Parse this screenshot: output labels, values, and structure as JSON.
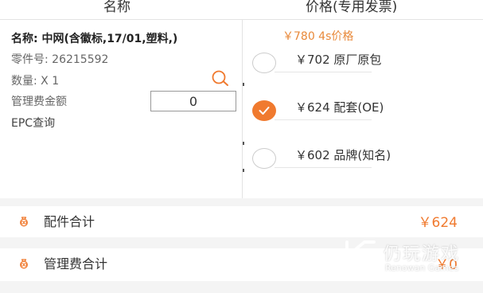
{
  "header": {
    "name_col": "名称",
    "price_col": "价格(专用发票)"
  },
  "part": {
    "name_line": "名称:  中网(含徽标,17/01,塑料,)",
    "part_number_line": "零件号:  26215592",
    "quantity_line": "数量:  X 1",
    "fee_label": "管理费金额",
    "fee_value": "0",
    "epc_label": "EPC查询"
  },
  "pricing": {
    "price_4s": "￥780 4s价格",
    "options": [
      {
        "label": "￥702 原厂原包",
        "selected": false
      },
      {
        "label": "￥624 配套(OE)",
        "selected": true
      },
      {
        "label": "￥602 品牌(知名)",
        "selected": false
      }
    ]
  },
  "summary": {
    "parts_total_label": "配件合计",
    "parts_total_value": "￥624",
    "fee_total_label": "管理费合计",
    "fee_total_value": "￥0"
  },
  "watermark": {
    "title": "仍玩游戏",
    "subtitle": "Renowan Games"
  },
  "colors": {
    "accent": "#f07a2f",
    "price_4s": "#e8893a",
    "background_gap": "#f4f4f4"
  },
  "icons": {
    "search": "search-icon",
    "selected_check": "check-icon",
    "summary": "bag-icon"
  }
}
